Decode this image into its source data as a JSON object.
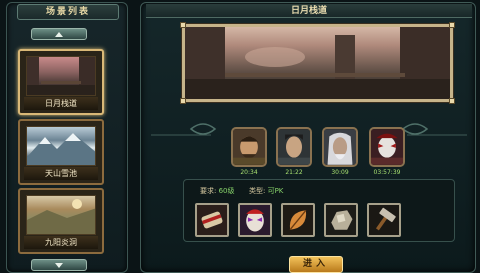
{
  "scene_list": {
    "title": "场景列表",
    "items": [
      {
        "label": "日月栈道",
        "selected": true
      },
      {
        "label": "天山雪池",
        "selected": false
      },
      {
        "label": "九阳炎洞",
        "selected": false
      }
    ]
  },
  "scene": {
    "title": "日月栈道",
    "bosses": [
      {
        "time": "20:34",
        "icon": "warrior-portrait-icon"
      },
      {
        "time": "21:22",
        "icon": "scholar-portrait-icon"
      },
      {
        "time": "30:09",
        "icon": "elder-portrait-icon"
      },
      {
        "time": "03:57:39",
        "icon": "masked-villain-portrait-icon"
      }
    ],
    "requirement": {
      "level_label": "要求:",
      "level_value": "60级",
      "type_label": "类型:",
      "type_value": "可PK"
    },
    "rewards": [
      "scroll-icon",
      "mask-icon",
      "leaf-blade-icon",
      "ore-icon",
      "hammer-icon"
    ],
    "enter_label": "进入"
  },
  "colors": {
    "timer": "#a8e070",
    "requirement_value": "#87d26a",
    "frame_gold": "#c6b48a",
    "button_gold": "#f2c25a"
  }
}
